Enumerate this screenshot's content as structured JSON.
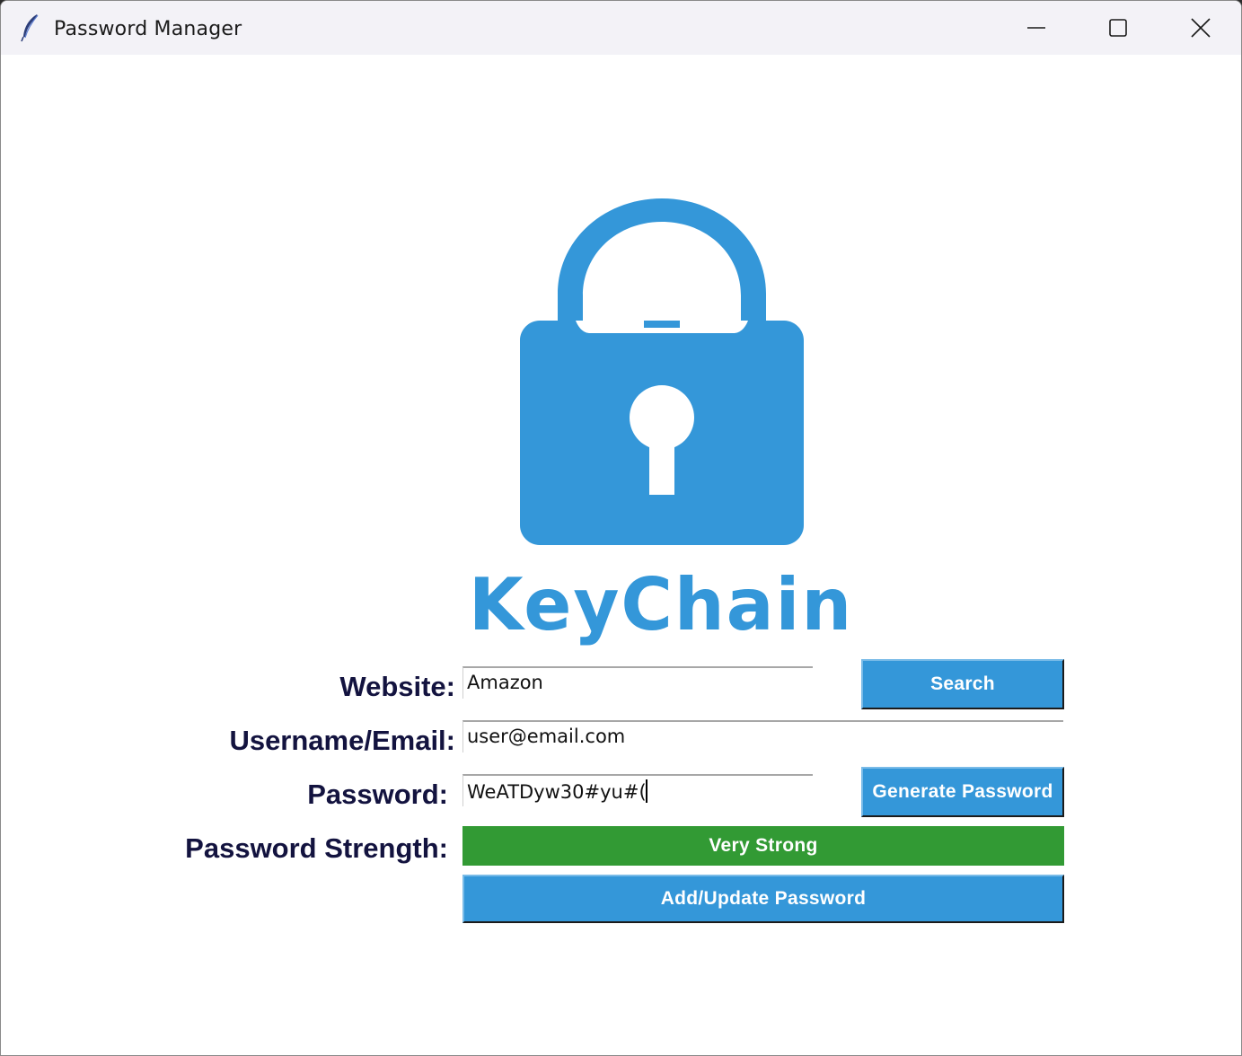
{
  "window": {
    "title": "Password Manager",
    "app_icon": "feather-icon",
    "controls": [
      "minimize-icon",
      "maximize-icon",
      "close-icon"
    ]
  },
  "brand": {
    "logo_icon": "padlock-icon",
    "name": "KeyChain",
    "color": "#3497d9"
  },
  "form": {
    "website_label": "Website:",
    "website_value": "Amazon",
    "search_button": "Search",
    "username_label": "Username/Email:",
    "username_value": "user@email.com",
    "password_label": "Password:",
    "password_value": "WeATDyw30#yu#(",
    "generate_button": "Generate Password",
    "strength_label": "Password Strength:",
    "strength_value": "Very Strong",
    "strength_color": "#329a34",
    "add_update_button": "Add/Update Password"
  }
}
